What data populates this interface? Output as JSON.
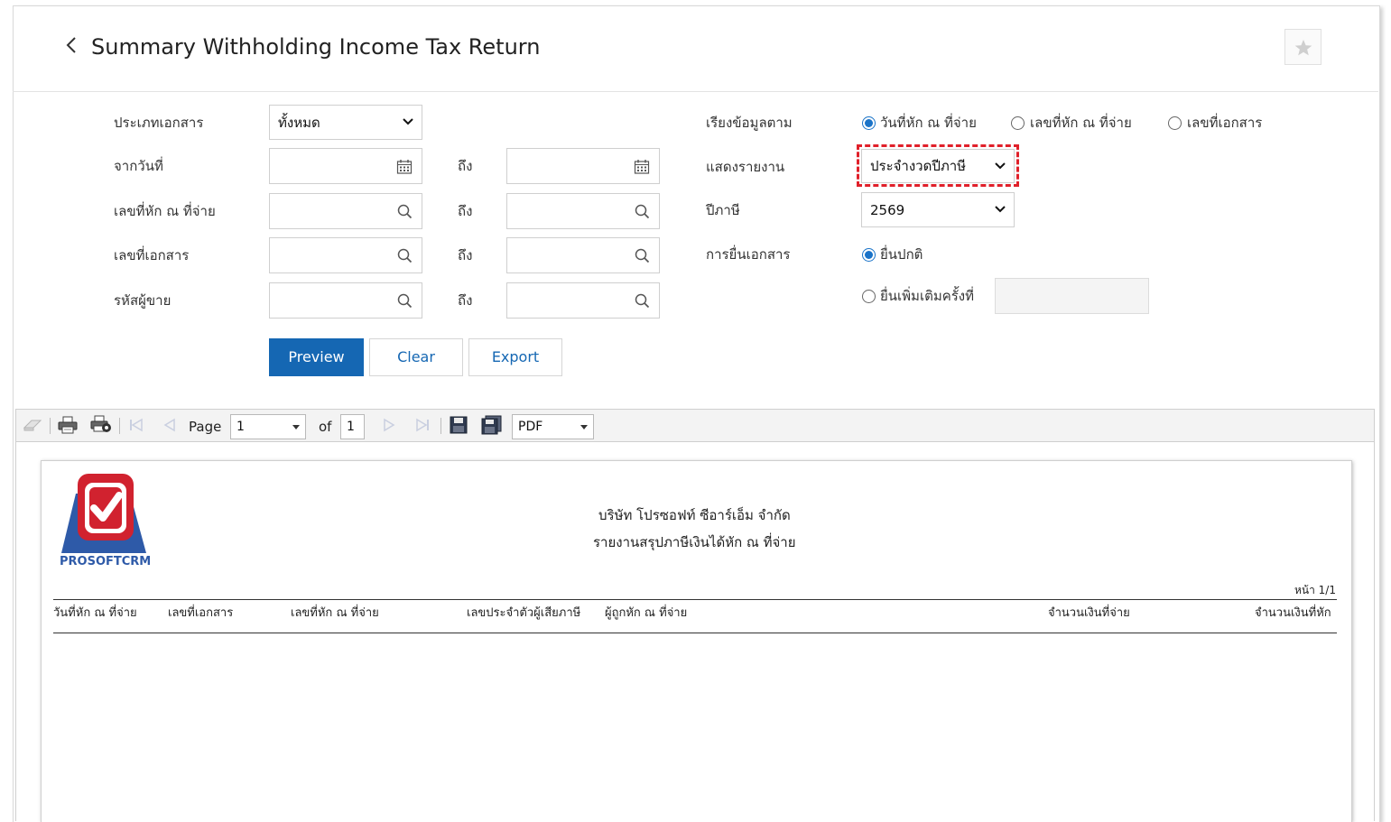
{
  "header": {
    "title": "Summary Withholding Income Tax Return",
    "back_icon": "chevron-left-icon",
    "favorite_icon": "star-icon"
  },
  "form": {
    "doc_type": {
      "label": "ประเภทเอกสาร",
      "value": "ทั้งหมด"
    },
    "from_date": {
      "label": "จากวันที่",
      "to_label": "ถึง",
      "from_value": "",
      "to_value": ""
    },
    "withholding_no": {
      "label": "เลขที่หัก ณ ที่จ่าย",
      "to_label": "ถึง",
      "from_value": "",
      "to_value": ""
    },
    "document_no": {
      "label": "เลขที่เอกสาร",
      "to_label": "ถึง",
      "from_value": "",
      "to_value": ""
    },
    "vendor_code": {
      "label": "รหัสผู้ขาย",
      "to_label": "ถึง",
      "from_value": "",
      "to_value": ""
    },
    "sort_by": {
      "label": "เรียงข้อมูลตาม",
      "options": [
        "วันที่หัก ณ ที่จ่าย",
        "เลขที่หัก ณ ที่จ่าย",
        "เลขที่เอกสาร"
      ],
      "selected": "วันที่หัก ณ ที่จ่าย"
    },
    "show_report": {
      "label": "แสดงรายงาน",
      "value": "ประจำงวดปีภาษี"
    },
    "tax_year": {
      "label": "ปีภาษี",
      "value": "2569"
    },
    "filing": {
      "label": "การยื่นเอกสาร",
      "options": [
        "ยื่นปกติ",
        "ยื่นเพิ่มเติมครั้งที่"
      ],
      "selected": "ยื่นปกติ",
      "additional_no": ""
    },
    "buttons": {
      "preview": "Preview",
      "clear": "Clear",
      "export": "Export"
    },
    "accent_color": "#1567b3",
    "highlight_color": "#e0202a"
  },
  "viewer": {
    "page_label": "Page",
    "page_value": "1",
    "of_label": "of",
    "total_pages": "1",
    "export_format": "PDF"
  },
  "report": {
    "logo_text": "PROSOFTCRM",
    "company": "บริษัท โปรซอฟท์ ซีอาร์เอ็ม จำกัด",
    "title": "รายงานสรุปภาษีเงินได้หัก ณ ที่จ่าย",
    "page_info": "หน้า 1/1",
    "columns": [
      "วันที่หัก ณ ที่จ่าย",
      "เลขที่เอกสาร",
      "เลขที่หัก ณ ที่จ่าย",
      "เลขประจำตัวผู้เสียภาษี",
      "ผู้ถูกหัก ณ ที่จ่าย",
      "จำนวนเงินที่จ่าย",
      "จำนวนเงินที่หัก"
    ]
  }
}
